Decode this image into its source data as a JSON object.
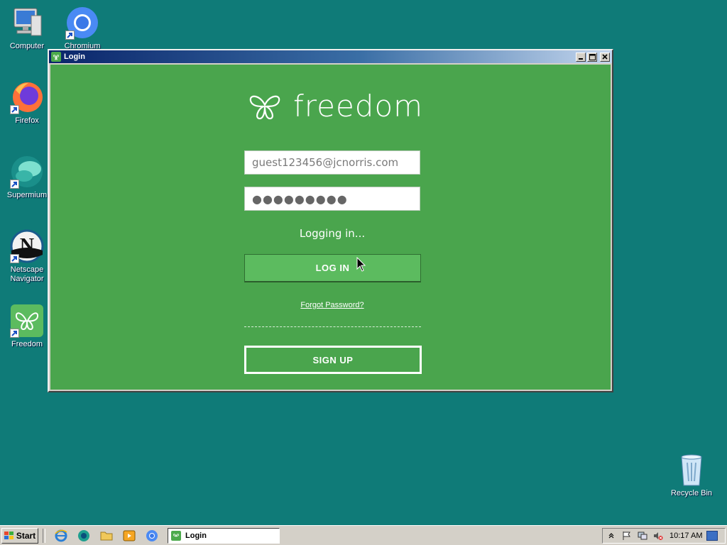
{
  "desktop": {
    "icons": [
      {
        "label": "Computer",
        "icon": "computer-icon"
      },
      {
        "label": "Chromium",
        "icon": "chromium-icon"
      },
      {
        "label": "Firefox",
        "icon": "firefox-icon"
      },
      {
        "label": "Supermium",
        "icon": "supermium-icon"
      },
      {
        "label": "Netscape Navigator",
        "icon": "netscape-icon"
      },
      {
        "label": "Freedom",
        "icon": "freedom-icon"
      },
      {
        "label": "Recycle Bin",
        "icon": "recycle-bin-icon"
      }
    ]
  },
  "window": {
    "title": "Login",
    "logo_text": "freedom",
    "email_value": "guest123456@jcnorris.com",
    "password_mask": "●●●●●●●●●",
    "status_text": "Logging in...",
    "login_label": "LOG IN",
    "forgot_label": "Forgot Password?",
    "signup_label": "SIGN UP"
  },
  "taskbar": {
    "start_label": "Start",
    "task_label": "Login",
    "clock": "10:17 AM",
    "quick_launch": [
      "ie-icon",
      "media-icon",
      "folder-icon",
      "player-icon",
      "chromium-icon"
    ]
  },
  "colors": {
    "desktop": "#0f7b78",
    "app_green": "#4aa54d",
    "button_green": "#5cbb5f"
  }
}
